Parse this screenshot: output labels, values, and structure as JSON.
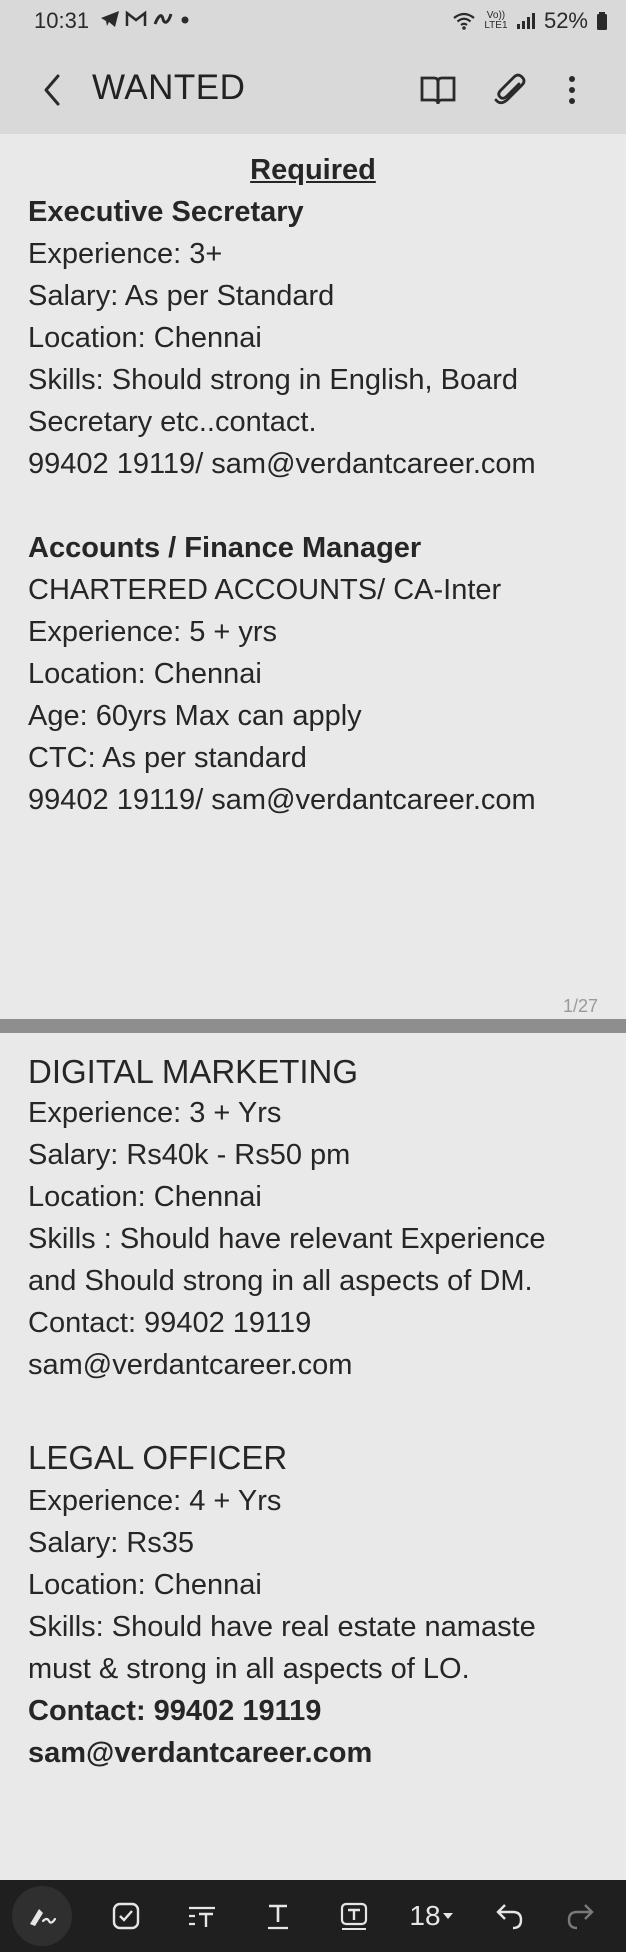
{
  "status": {
    "time": "10:31",
    "battery": "52%",
    "left_icons": [
      "telegram-icon",
      "gmail-icon",
      "app-icon",
      "dot-icon"
    ],
    "right_icons": [
      "wifi-icon",
      "volte-icon",
      "signal-icon",
      "battery-icon"
    ],
    "volte_text": "Vo)) LTE1"
  },
  "header": {
    "title": "WANTED",
    "icons": [
      "book-icon",
      "attachment-icon",
      "more-icon"
    ]
  },
  "page1": {
    "heading": "Required",
    "page_indicator": "1/27",
    "jobs": [
      {
        "title": "Executive Secretary",
        "lines": [
          "Experience: 3+",
          "Salary: As per Standard",
          "Location: Chennai",
          "Skills: Should strong in English, Board",
          "Secretary etc..contact.",
          "99402 19119/ sam@verdantcareer.com"
        ]
      },
      {
        "title": "Accounts / Finance  Manager",
        "lines": [
          "CHARTERED ACCOUNTS/ CA-Inter",
          "Experience: 5 + yrs",
          "Location: Chennai",
          "Age: 60yrs Max can apply",
          "CTC: As per standard",
          "99402 19119/ sam@verdantcareer.com"
        ]
      }
    ]
  },
  "page2": {
    "jobs": [
      {
        "title": "DIGITAL MARKETING",
        "lines": [
          "Experience: 3 + Yrs",
          "Salary: Rs40k - Rs50 pm",
          "Location: Chennai",
          "Skills : Should have relevant Experience",
          "and Should strong in all aspects of DM.",
          "Contact: 99402 19119",
          "sam@verdantcareer.com"
        ]
      },
      {
        "title": "LEGAL OFFICER",
        "lines": [
          "Experience: 4 + Yrs",
          "Salary: Rs35",
          "Location: Chennai",
          "Skills: Should have real estate namaste",
          "must & strong in all aspects of LO."
        ],
        "bold_lines": [
          "Contact: 99402 19119",
          "sam@verdantcareer.com"
        ]
      }
    ]
  },
  "toolbar": {
    "font_size": "18",
    "tools": [
      "pen-icon",
      "checkbox-icon",
      "text-style-icon",
      "underline-icon",
      "text-box-icon",
      "font-size-dropdown",
      "undo-icon",
      "redo-icon"
    ]
  }
}
